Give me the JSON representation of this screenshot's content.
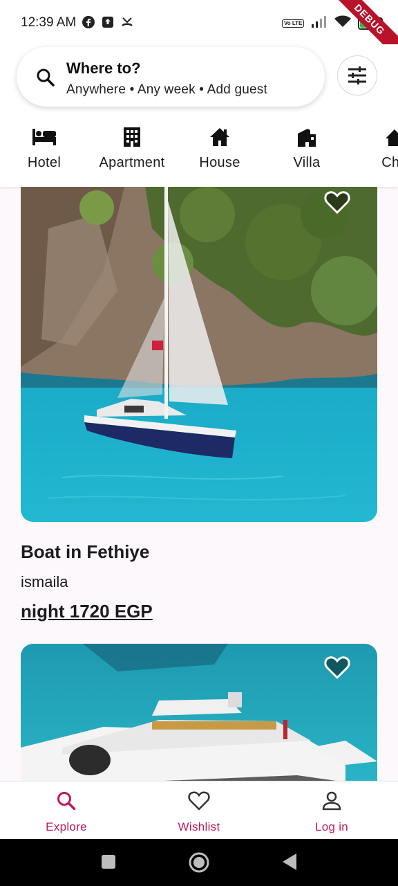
{
  "status_bar": {
    "time": "12:39 AM",
    "battery": "49",
    "debug_banner": "DEBUG",
    "volte": "Vo LTE"
  },
  "search": {
    "title": "Where to?",
    "subtitle": "Anywhere • Any week • Add guest"
  },
  "categories": [
    {
      "label": "Hotel",
      "icon": "bed-icon"
    },
    {
      "label": "Apartment",
      "icon": "building-icon"
    },
    {
      "label": "House",
      "icon": "house-icon"
    },
    {
      "label": "Villa",
      "icon": "villa-icon"
    },
    {
      "label": "Cha",
      "icon": "chalet-icon"
    }
  ],
  "listings": [
    {
      "title": "Boat in Fethiye",
      "host": "ismaila",
      "price": "night 1720 EGP"
    }
  ],
  "bottom_nav": {
    "explore": "Explore",
    "wishlist": "Wishlist",
    "login": "Log in"
  },
  "colors": {
    "accent": "#c2185b",
    "water": "#1aa7c4",
    "debug": "#b8132b"
  }
}
